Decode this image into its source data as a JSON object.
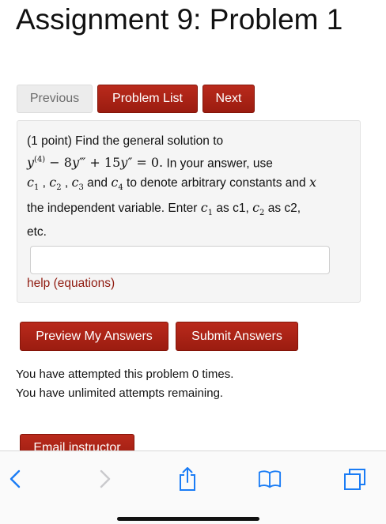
{
  "page": {
    "title": "Assignment 9: Problem 1"
  },
  "nav": {
    "previous_label": "Previous",
    "problem_list_label": "Problem List",
    "next_label": "Next"
  },
  "problem": {
    "intro": "(1 point) Find the general solution to",
    "equation": {
      "term1": "y",
      "term1_sup": "(4)",
      "op1": " − 8",
      "term2": "y‴",
      "op2": " + 15",
      "term3": "y″",
      "rhs": " = 0."
    },
    "text_after_equation": " In your answer, use",
    "const1": "c",
    "const1_sub": "1",
    "sep1": " , ",
    "const2": "c",
    "const2_sub": "2",
    "sep2": " , ",
    "const3": "c",
    "const3_sub": "3",
    "and_text": " and ",
    "const4": "c",
    "const4_sub": "4",
    "denote_text": " to denote arbitrary constants and ",
    "var_x": "x",
    "line4_text": "the independent variable. Enter ",
    "as_c1_text": " as c1, ",
    "as_c2_text": " as c2,",
    "etc_text": "etc.",
    "answer_value": "",
    "help_link": "help (equations)"
  },
  "actions": {
    "preview_label": "Preview My Answers",
    "submit_label": "Submit Answers",
    "email_label": "Email instructor"
  },
  "attempts": {
    "line1": "You have attempted this problem 0 times.",
    "line2": "You have unlimited attempts remaining."
  },
  "toolbar": {
    "icons": [
      "back-icon",
      "forward-icon",
      "share-icon",
      "bookmarks-icon",
      "tabs-icon"
    ],
    "tint_color": "#1a7cf5"
  }
}
